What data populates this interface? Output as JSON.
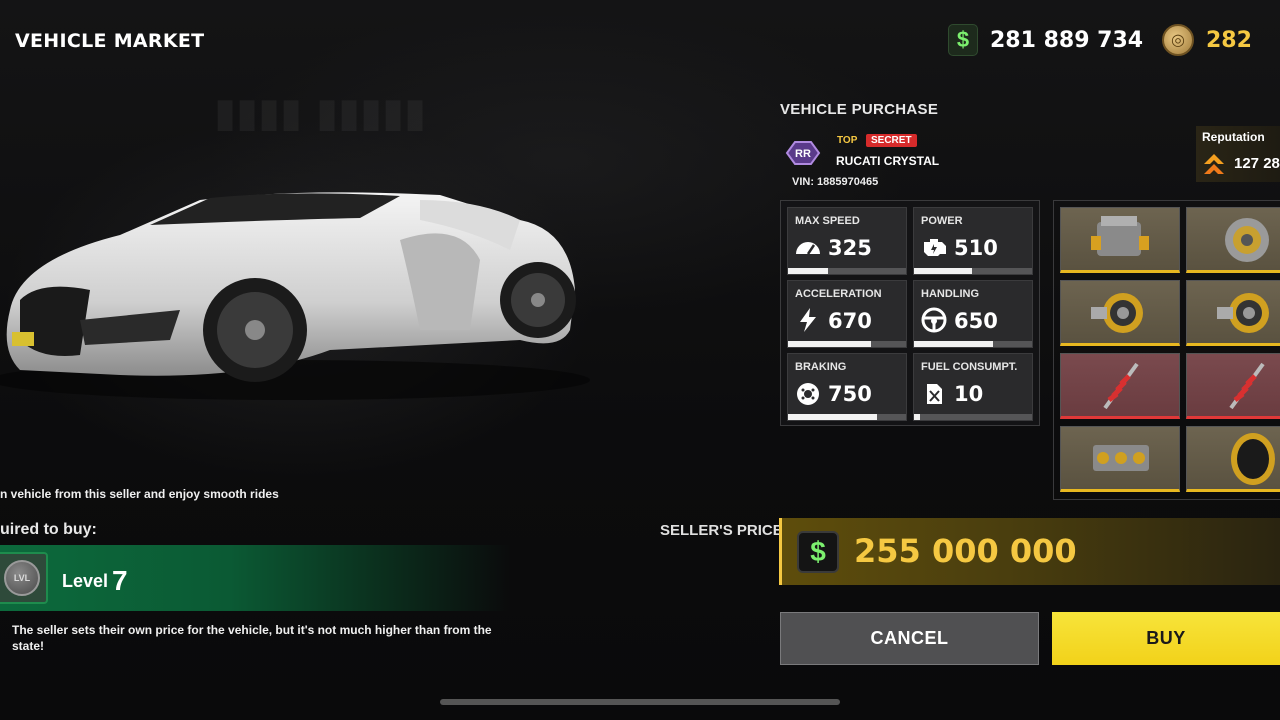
{
  "header": {
    "title": "VEHICLE MARKET",
    "money": "281 889 734",
    "money_icon": "dollar-icon",
    "coins": "282",
    "coin_icon": "coin-icon"
  },
  "left": {
    "info_line": "n vehicle from this seller and enjoy smooth rides",
    "required_label": "uired to buy:",
    "level_badge": "LVL",
    "level_label": "Level",
    "level_value": "7",
    "note": "The seller sets their own price for the vehicle, but it's not much higher than from the state!"
  },
  "purchase": {
    "title": "VEHICLE PURCHASE",
    "brand_logo_text": "RR",
    "tag_top": "TOP",
    "tag_secret": "SECRET",
    "car_name": "RUCATI CRYSTAL",
    "vin": "VIN: 1885970465",
    "reputation_label": "Reputation",
    "reputation_value": "127 28"
  },
  "stats": [
    {
      "label": "MAX SPEED",
      "value": "325",
      "icon": "speedometer-icon",
      "fill": 0.34
    },
    {
      "label": "POWER",
      "value": "510",
      "icon": "engine-icon",
      "fill": 0.49
    },
    {
      "label": "ACCELERATION",
      "value": "670",
      "icon": "lightning-icon",
      "fill": 0.7
    },
    {
      "label": "HANDLING",
      "value": "650",
      "icon": "steering-wheel-icon",
      "fill": 0.67
    },
    {
      "label": "BRAKING",
      "value": "750",
      "icon": "brake-disc-icon",
      "fill": 0.75
    },
    {
      "label": "FUEL CONSUMPT.",
      "value": "10",
      "icon": "fuel-can-icon",
      "fill": 0.05
    }
  ],
  "parts": [
    {
      "name": "engine",
      "rarity": "gold"
    },
    {
      "name": "clutch",
      "rarity": "gold"
    },
    {
      "name": "turbo",
      "rarity": "gold"
    },
    {
      "name": "turbo",
      "rarity": "gold"
    },
    {
      "name": "suspension",
      "rarity": "red"
    },
    {
      "name": "suspension",
      "rarity": "red"
    },
    {
      "name": "transmission",
      "rarity": "gold"
    },
    {
      "name": "tire",
      "rarity": "gold"
    }
  ],
  "price": {
    "label": "SELLER'S PRICE:",
    "value": "255 000 000"
  },
  "buttons": {
    "cancel": "CANCEL",
    "buy": "BUY"
  },
  "colors": {
    "accent_gold": "#f5c842",
    "buy_yellow": "#f2d21a",
    "money_green": "#7cf06e",
    "secret_red": "#d62b2b",
    "level_green": "#0c6a3c"
  }
}
